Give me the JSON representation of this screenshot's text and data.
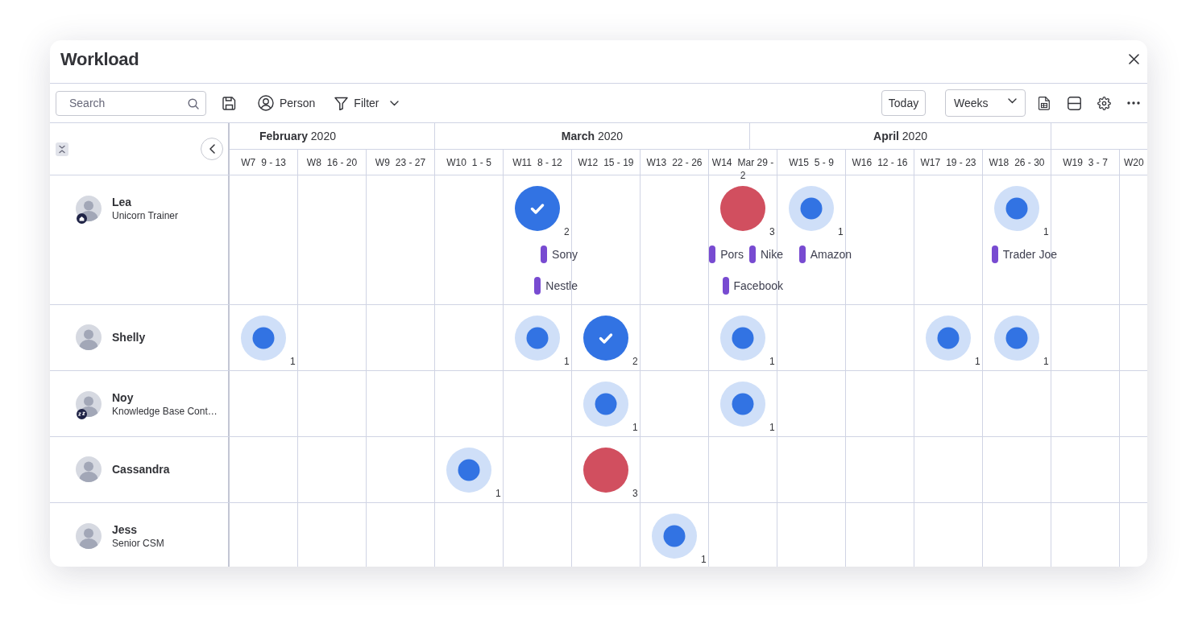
{
  "window": {
    "title": "Workload"
  },
  "toolbar": {
    "search": {
      "placeholder": "Search"
    },
    "person_button": "Person",
    "filter_button": "Filter",
    "today_button": "Today",
    "view_select": "Weeks"
  },
  "timeline": {
    "months": [
      {
        "label": "**February** 2020"
      },
      {
        "label": "**March** 2020"
      },
      {
        "label": "**April** 2020"
      }
    ],
    "weeks": [
      {
        "number": "W7",
        "range": "9 - 13"
      },
      {
        "number": "W8",
        "range": "16 - 20"
      },
      {
        "number": "W9",
        "range": "23 - 27"
      },
      {
        "number": "W10",
        "range": "1 - 5"
      },
      {
        "number": "W11",
        "range": "8 - 12"
      },
      {
        "number": "W12",
        "range": "15 - 19"
      },
      {
        "number": "W13",
        "range": "22 - 26"
      },
      {
        "number": "W14",
        "range": "Mar 29 - 2"
      },
      {
        "number": "W15",
        "range": "5 - 9"
      },
      {
        "number": "W16",
        "range": "12 - 16"
      },
      {
        "number": "W17",
        "range": "19 - 23"
      },
      {
        "number": "W18",
        "range": "26 - 30"
      },
      {
        "number": "W19",
        "range": "3 - 7"
      },
      {
        "number": "W20"
      }
    ]
  },
  "people": [
    {
      "name": "Lea",
      "title": "Unicorn Trainer",
      "badge": {
        "kind": "home"
      },
      "cells": [
        {
          "kind": "empty"
        },
        {
          "kind": "empty"
        },
        {
          "kind": "empty"
        },
        {
          "kind": "empty"
        },
        {
          "kind": "done",
          "count": "2",
          "tags": [
            {
              "label": "Sony"
            },
            {
              "label": "Nestle"
            }
          ]
        },
        {
          "kind": "empty"
        },
        {
          "kind": "empty"
        },
        {
          "kind": "over",
          "count": "3",
          "tags": [
            {
              "label": "Pors"
            },
            {
              "label": "Nike"
            },
            {
              "label": "Facebook"
            }
          ]
        },
        {
          "kind": "partial",
          "count": "1",
          "tags": [
            {
              "label": "Amazon"
            }
          ]
        },
        {
          "kind": "empty"
        },
        {
          "kind": "empty"
        },
        {
          "kind": "partial",
          "count": "1",
          "tags": [
            {
              "label": "Trader Joe"
            }
          ]
        },
        {
          "kind": "empty"
        },
        {
          "kind": "empty"
        }
      ]
    },
    {
      "name": "Shelly",
      "cells": [
        {
          "kind": "partial",
          "count": "1"
        },
        {
          "kind": "empty"
        },
        {
          "kind": "empty"
        },
        {
          "kind": "empty"
        },
        {
          "kind": "partial",
          "count": "1"
        },
        {
          "kind": "done",
          "count": "2"
        },
        {
          "kind": "empty"
        },
        {
          "kind": "partial",
          "count": "1"
        },
        {
          "kind": "empty"
        },
        {
          "kind": "empty"
        },
        {
          "kind": "partial",
          "count": "1"
        },
        {
          "kind": "partial",
          "count": "1"
        },
        {
          "kind": "empty"
        },
        {
          "kind": "empty"
        }
      ]
    },
    {
      "name": "Noy",
      "title": "Knowledge Base Cont…",
      "badge": {
        "kind": "away"
      },
      "cells": [
        {
          "kind": "empty"
        },
        {
          "kind": "empty"
        },
        {
          "kind": "empty"
        },
        {
          "kind": "empty"
        },
        {
          "kind": "empty"
        },
        {
          "kind": "partial",
          "count": "1"
        },
        {
          "kind": "empty"
        },
        {
          "kind": "partial",
          "count": "1"
        },
        {
          "kind": "empty"
        },
        {
          "kind": "empty"
        },
        {
          "kind": "empty"
        },
        {
          "kind": "empty"
        },
        {
          "kind": "empty"
        },
        {
          "kind": "empty"
        }
      ]
    },
    {
      "name": "Cassandra",
      "cells": [
        {
          "kind": "empty"
        },
        {
          "kind": "empty"
        },
        {
          "kind": "empty"
        },
        {
          "kind": "partial",
          "count": "1"
        },
        {
          "kind": "empty"
        },
        {
          "kind": "over",
          "count": "3"
        },
        {
          "kind": "empty"
        },
        {
          "kind": "empty"
        },
        {
          "kind": "empty"
        },
        {
          "kind": "empty"
        },
        {
          "kind": "empty"
        },
        {
          "kind": "empty"
        },
        {
          "kind": "empty"
        },
        {
          "kind": "empty"
        }
      ]
    },
    {
      "name": "Jess",
      "title": "Senior CSM",
      "cells": [
        {
          "kind": "empty"
        },
        {
          "kind": "empty"
        },
        {
          "kind": "empty"
        },
        {
          "kind": "empty"
        },
        {
          "kind": "empty"
        },
        {
          "kind": "empty"
        },
        {
          "kind": "partial",
          "count": "1"
        },
        {
          "kind": "empty"
        },
        {
          "kind": "empty"
        },
        {
          "kind": "empty"
        },
        {
          "kind": "empty"
        },
        {
          "kind": "empty"
        },
        {
          "kind": "empty"
        },
        {
          "kind": "empty"
        }
      ]
    }
  ]
}
